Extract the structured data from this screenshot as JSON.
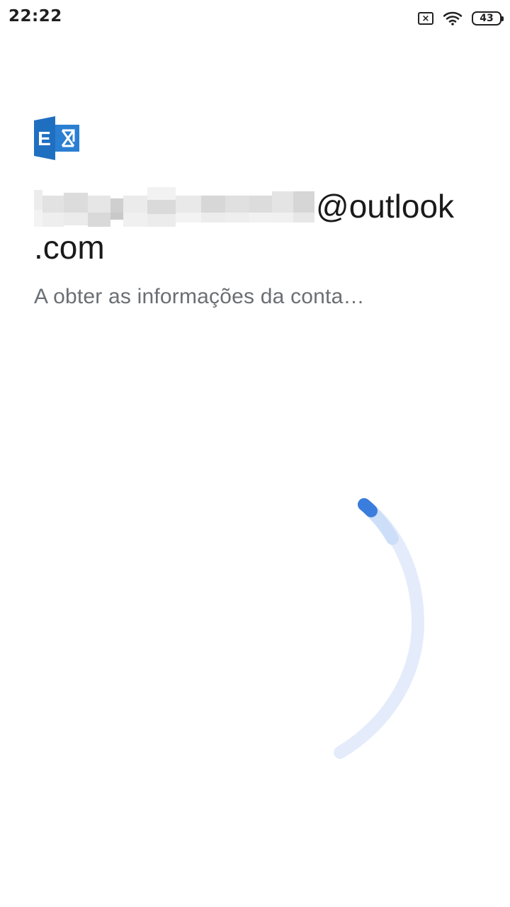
{
  "status_bar": {
    "time": "22:22",
    "sim_icon": "no-sim-icon",
    "sim_glyph": "×",
    "wifi_icon": "wifi-icon",
    "battery_level": "43"
  },
  "app": {
    "logo_icon": "exchange-logo-icon",
    "logo_letter": "E",
    "account": {
      "email_domain_part1": "@outlook",
      "email_domain_part2": ".com",
      "username_redacted": true
    },
    "status_message": "A obter as informações da conta…"
  },
  "spinner": {
    "icon": "loading-spinner-icon",
    "accent_color": "#3b7ddd",
    "track_color": "#e3ecfb"
  },
  "colors": {
    "exchange_blue": "#1f6fc1",
    "text_primary": "#1a1a1a",
    "text_secondary": "#6a6f74"
  }
}
